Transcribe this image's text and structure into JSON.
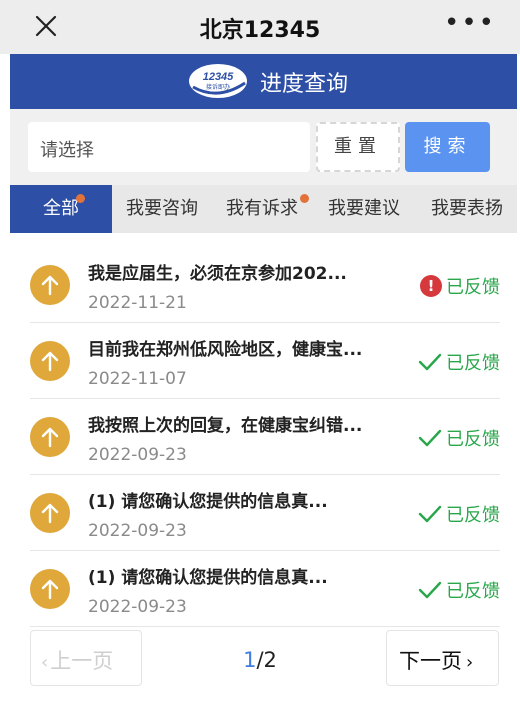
{
  "header": {
    "title": "北京12345",
    "more": "•••"
  },
  "banner": {
    "logo_text": "12345",
    "logo_sub": "接诉即办",
    "title": "进度查询"
  },
  "search": {
    "placeholder": "请选择",
    "reset_label": "重置",
    "search_label": "搜索"
  },
  "tabs": [
    {
      "label": "全部",
      "dot": true,
      "active": true
    },
    {
      "label": "我要咨询",
      "dot": false,
      "active": false
    },
    {
      "label": "我有诉求",
      "dot": true,
      "active": false
    },
    {
      "label": "我要建议",
      "dot": false,
      "active": false
    },
    {
      "label": "我要表扬",
      "dot": false,
      "active": false
    }
  ],
  "items": [
    {
      "title": "我是应届生，必须在京参加202...",
      "date": "2022-11-21",
      "status": "已反馈",
      "status_icon": "alert-icon",
      "status_color": "#2aa64b"
    },
    {
      "title": "目前我在郑州低风险地区，健康宝...",
      "date": "2022-11-07",
      "status": "已反馈",
      "status_icon": "check-icon",
      "status_color": "#2aa64b"
    },
    {
      "title": "我按照上次的回复，在健康宝纠错...",
      "date": "2022-09-23",
      "status": "已反馈",
      "status_icon": "check-icon",
      "status_color": "#2aa64b"
    },
    {
      "title": "(1) 请您确认您提供的信息真...",
      "date": "2022-09-23",
      "status": "已反馈",
      "status_icon": "check-icon",
      "status_color": "#2aa64b"
    },
    {
      "title": "(1) 请您确认您提供的信息真...",
      "date": "2022-09-23",
      "status": "已反馈",
      "status_icon": "check-icon",
      "status_color": "#2aa64b"
    }
  ],
  "pagination": {
    "prev_label": "上一页",
    "next_label": "下一页",
    "current": "1",
    "total": "2"
  },
  "colors": {
    "brand_blue": "#2d4fa5",
    "search_button": "#5b94f0",
    "badge_orange": "#e0a83a",
    "feedback_green": "#2aa64b",
    "alert_red": "#d6393c"
  }
}
